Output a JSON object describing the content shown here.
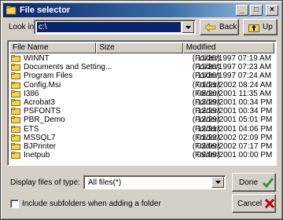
{
  "window": {
    "title": "File selector",
    "minimize": "_",
    "maximize": "□",
    "close": "×"
  },
  "toolbar": {
    "look_in_label": "Look in:",
    "look_in_value": "c:\\",
    "back_label": "Back",
    "up_label": "Up"
  },
  "list": {
    "columns": [
      "File Name",
      "Size",
      "Modified"
    ],
    "rows": [
      {
        "name": "WINNT",
        "size": "(Folder)",
        "modified": "11/20/1997 07:19 AM"
      },
      {
        "name": "Documents and Setting...",
        "size": "(Folder)",
        "modified": "11/20/1997 07:23 AM"
      },
      {
        "name": "Program Files",
        "size": "(Folder)",
        "modified": "11/20/1997 07:24 AM"
      },
      {
        "name": "Config.Msi",
        "size": "(Folder)",
        "modified": "01/21/2002 08:24 AM"
      },
      {
        "name": "I386",
        "size": "(Folder)",
        "modified": "08/20/2001 11:35 AM"
      },
      {
        "name": "Acrobat3",
        "size": "(Folder)",
        "modified": "12/29/2001 00:34 PM"
      },
      {
        "name": "PSFONTS",
        "size": "(Folder)",
        "modified": "12/29/2001 00:34 PM"
      },
      {
        "name": "PBR_Demo",
        "size": "(Folder)",
        "modified": "12/29/2001 05:01 PM"
      },
      {
        "name": "ETS",
        "size": "(Folder)",
        "modified": "12/31/2001 04:06 PM"
      },
      {
        "name": "MSSQL7",
        "size": "(Folder)",
        "modified": "01/22/2002 02:09 PM"
      },
      {
        "name": "BJPrinter",
        "size": "(Folder)",
        "modified": "03/09/2002 07:17 PM"
      },
      {
        "name": "Inetpub",
        "size": "(Folder)",
        "modified": "09/09/2001 00:00 PM"
      }
    ]
  },
  "filter": {
    "label": "Display files of type:",
    "value": "All files(*)"
  },
  "buttons": {
    "done_label": "Done",
    "cancel_label": "Cancel"
  },
  "options": {
    "subfolders_label": "Include subfolders when adding a folder",
    "subfolders_checked": false
  },
  "colors": {
    "titlebar": "#0a246a",
    "face": "#d4d0c8",
    "folder": "#f5d15a",
    "selection": "#0a246a",
    "done_check": "#2e9a2e",
    "cancel_x": "#c00000"
  }
}
